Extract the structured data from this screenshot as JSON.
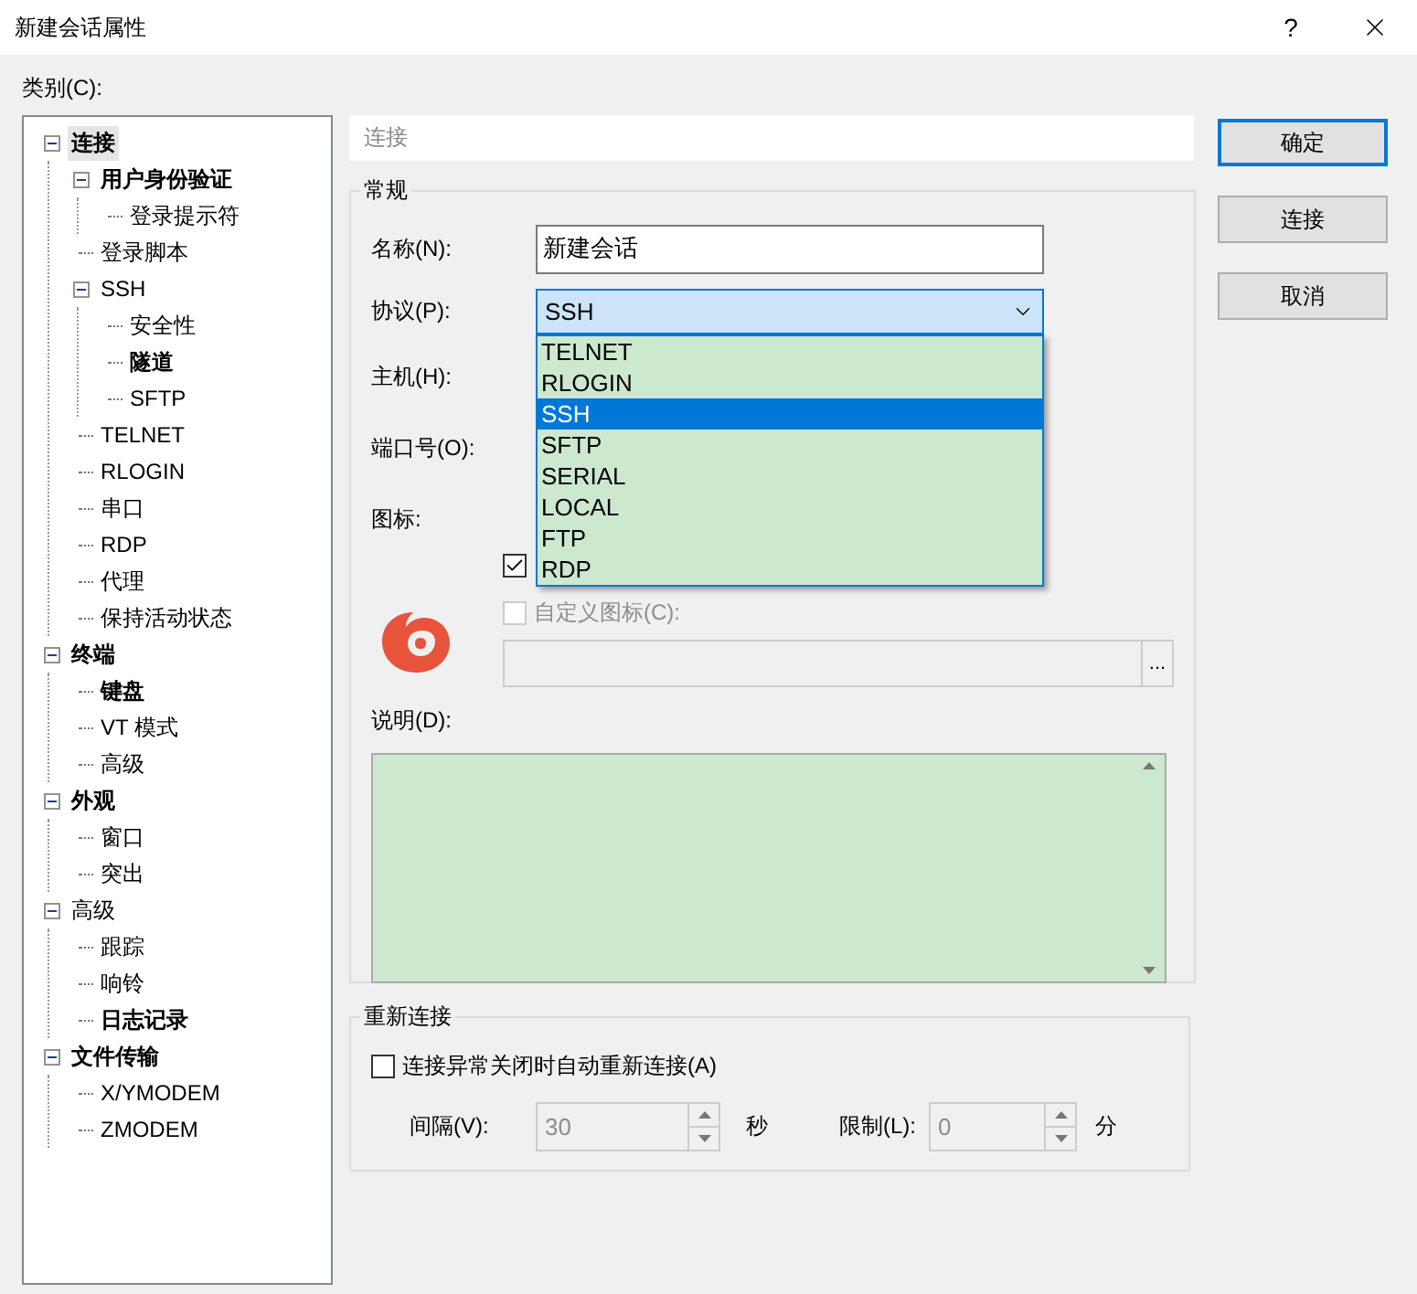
{
  "window": {
    "title": "新建会话属性",
    "help": "?"
  },
  "category_label": "类别(C):",
  "tree": [
    {
      "label": "连接",
      "bold": true,
      "selected": true,
      "expanded": true,
      "children": [
        {
          "label": "用户身份验证",
          "bold": true,
          "selected": false,
          "expanded": true,
          "children": [
            {
              "label": "登录提示符",
              "bold": false,
              "selected": false
            }
          ]
        },
        {
          "label": "登录脚本",
          "bold": false,
          "selected": false
        },
        {
          "label": "SSH",
          "bold": false,
          "selected": false,
          "expanded": true,
          "children": [
            {
              "label": "安全性",
              "bold": false,
              "selected": false
            },
            {
              "label": "隧道",
              "bold": true,
              "selected": false
            },
            {
              "label": "SFTP",
              "bold": false,
              "selected": false
            }
          ]
        },
        {
          "label": "TELNET",
          "bold": false,
          "selected": false
        },
        {
          "label": "RLOGIN",
          "bold": false,
          "selected": false
        },
        {
          "label": "串口",
          "bold": false,
          "selected": false
        },
        {
          "label": "RDP",
          "bold": false,
          "selected": false
        },
        {
          "label": "代理",
          "bold": false,
          "selected": false
        },
        {
          "label": "保持活动状态",
          "bold": false,
          "selected": false
        }
      ]
    },
    {
      "label": "终端",
      "bold": true,
      "selected": false,
      "expanded": true,
      "children": [
        {
          "label": "键盘",
          "bold": true,
          "selected": false
        },
        {
          "label": "VT 模式",
          "bold": false,
          "selected": false
        },
        {
          "label": "高级",
          "bold": false,
          "selected": false
        }
      ]
    },
    {
      "label": "外观",
      "bold": true,
      "selected": false,
      "expanded": true,
      "children": [
        {
          "label": "窗口",
          "bold": false,
          "selected": false
        },
        {
          "label": "突出",
          "bold": false,
          "selected": false
        }
      ]
    },
    {
      "label": "高级",
      "bold": false,
      "selected": false,
      "expanded": true,
      "children": [
        {
          "label": "跟踪",
          "bold": false,
          "selected": false
        },
        {
          "label": "响铃",
          "bold": false,
          "selected": false
        },
        {
          "label": "日志记录",
          "bold": true,
          "selected": false
        }
      ]
    },
    {
      "label": "文件传输",
      "bold": true,
      "selected": false,
      "expanded": true,
      "children": [
        {
          "label": "X/YMODEM",
          "bold": false,
          "selected": false
        },
        {
          "label": "ZMODEM",
          "bold": false,
          "selected": false
        }
      ]
    }
  ],
  "section_header": "连接",
  "general": {
    "title": "常规",
    "name": {
      "label": "名称(N):",
      "value": "新建会话"
    },
    "protocol": {
      "label": "协议(P):",
      "value": "SSH",
      "expanded": true,
      "options": [
        {
          "label": "TELNET",
          "selected": false
        },
        {
          "label": "RLOGIN",
          "selected": false
        },
        {
          "label": "SSH",
          "selected": true
        },
        {
          "label": "SFTP",
          "selected": false
        },
        {
          "label": "SERIAL",
          "selected": false
        },
        {
          "label": "LOCAL",
          "selected": false
        },
        {
          "label": "FTP",
          "selected": false
        },
        {
          "label": "RDP",
          "selected": false
        }
      ]
    },
    "host": {
      "label": "主机(H):"
    },
    "port": {
      "label": "端口号(O):"
    },
    "icon": {
      "label": "图标:",
      "default_checked": true,
      "custom": {
        "label": "自定义图标(C):",
        "checked": false,
        "disabled": true
      },
      "browse": "..."
    },
    "description": {
      "label": "说明(D):"
    }
  },
  "reconnect": {
    "title": "重新连接",
    "auto": {
      "label": "连接异常关闭时自动重新连接(A)",
      "checked": false
    },
    "interval": {
      "label": "间隔(V):",
      "value": "30",
      "disabled": true,
      "unit": "秒"
    },
    "limit": {
      "label": "限制(L):",
      "value": "0",
      "disabled": true,
      "unit": "分"
    }
  },
  "buttons": [
    {
      "label": "确定",
      "default": true
    },
    {
      "label": "连接",
      "default": false
    },
    {
      "label": "取消",
      "default": false
    }
  ]
}
